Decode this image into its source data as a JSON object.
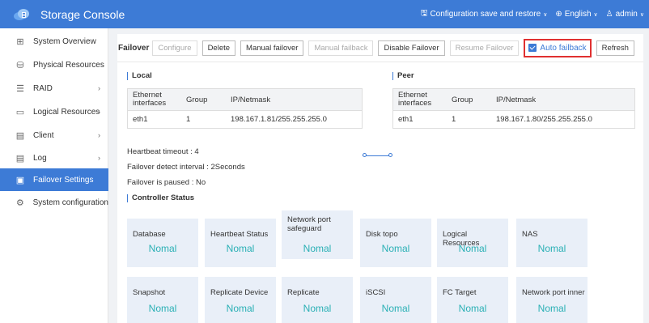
{
  "app": {
    "title": "Storage Console",
    "logo_icon": "cloud-logo-icon",
    "brand_color": "#3d7bd6"
  },
  "topbar": {
    "config_label": "Configuration save and restore",
    "language_label": "English",
    "user_label": "admin"
  },
  "sidebar": {
    "items": [
      {
        "label": "System Overview",
        "icon": "grid-icon",
        "has_arrow": false,
        "active": false
      },
      {
        "label": "Physical Resources",
        "icon": "database-icon",
        "has_arrow": false,
        "active": false
      },
      {
        "label": "RAID",
        "icon": "raid-icon",
        "has_arrow": true,
        "active": false
      },
      {
        "label": "Logical Resources",
        "icon": "folder-icon",
        "has_arrow": true,
        "active": false
      },
      {
        "label": "Client",
        "icon": "client-icon",
        "has_arrow": true,
        "active": false
      },
      {
        "label": "Log",
        "icon": "log-icon",
        "has_arrow": true,
        "active": false
      },
      {
        "label": "Failover Settings",
        "icon": "failover-icon",
        "has_arrow": false,
        "active": true
      },
      {
        "label": "System configuration",
        "icon": "gear-icon",
        "has_arrow": true,
        "active": false
      }
    ]
  },
  "toolbar": {
    "title": "Failover",
    "configure": "Configure",
    "delete": "Delete",
    "manual_failover": "Manual failover",
    "manual_failback": "Manual failback",
    "disable_failover": "Disable Failover",
    "resume_failover": "Resume Failover",
    "auto_failback": "Auto failback",
    "auto_failback_checked": true,
    "refresh": "Refresh"
  },
  "local": {
    "title": "Local",
    "headers": {
      "iface": "Ethernet interfaces",
      "group": "Group",
      "ip": "IP/Netmask"
    },
    "row": {
      "iface": "eth1",
      "group": "1",
      "ip": "198.167.1.81/255.255.255.0"
    }
  },
  "peer": {
    "title": "Peer",
    "headers": {
      "iface": "Ethernet interfaces",
      "group": "Group",
      "ip": "IP/Netmask"
    },
    "row": {
      "iface": "eth1",
      "group": "1",
      "ip": "198.167.1.80/255.255.255.0"
    }
  },
  "info": {
    "heartbeat_timeout": "Heartbeat timeout : 4",
    "detect_interval": "Failover detect interval : 2Seconds",
    "paused": "Failover is paused : No"
  },
  "controller": {
    "title": "Controller Status",
    "status_color": "#2ab0b5",
    "cards": [
      {
        "label": "Database",
        "value": "Nomal"
      },
      {
        "label": "Heartbeat Status",
        "value": "Nomal"
      },
      {
        "label": "Network port safeguard",
        "value": "Nomal"
      },
      {
        "label": "Disk topo",
        "value": "Nomal"
      },
      {
        "label": "Logical Resources",
        "value": "Nomal"
      },
      {
        "label": "NAS",
        "value": "Nomal"
      },
      {
        "label": "Snapshot",
        "value": "Nomal"
      },
      {
        "label": "Replicate Device",
        "value": "Nomal"
      },
      {
        "label": "Replicate",
        "value": "Nomal"
      },
      {
        "label": "iSCSI",
        "value": "Nomal"
      },
      {
        "label": "FC Target",
        "value": "Nomal"
      },
      {
        "label": "Network port inner",
        "value": "Nomal"
      }
    ]
  }
}
